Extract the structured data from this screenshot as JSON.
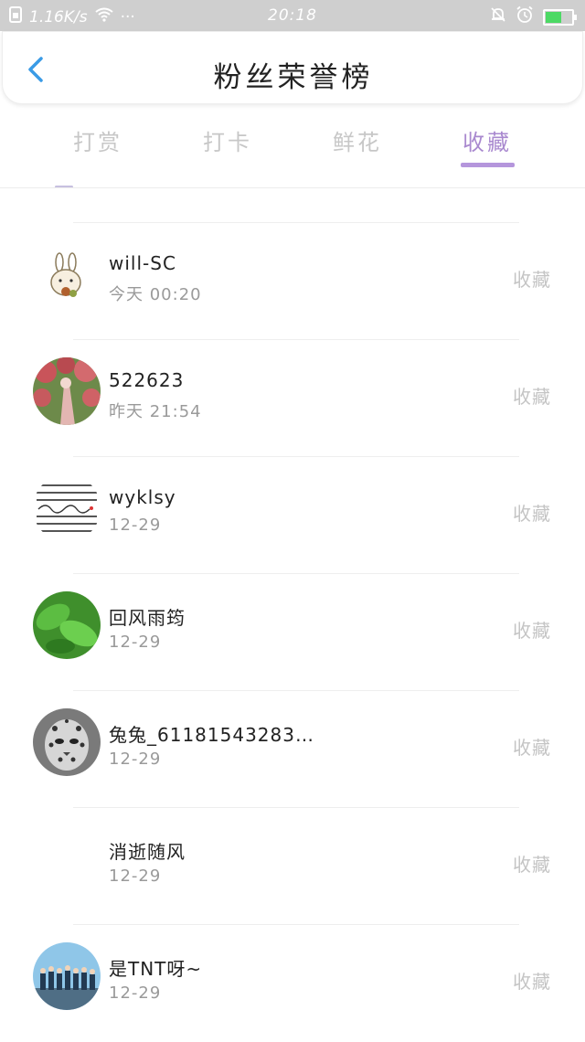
{
  "status_bar": {
    "speed": "1.16K/s",
    "dots": "···",
    "time": "20:18"
  },
  "header": {
    "title": "粉丝荣誉榜"
  },
  "tabs": [
    {
      "label": "打赏",
      "active": false
    },
    {
      "label": "打卡",
      "active": false
    },
    {
      "label": "鲜花",
      "active": false
    },
    {
      "label": "收藏",
      "active": true
    }
  ],
  "colors": {
    "accent": "#a989cf",
    "status_bar": "#cfcfcf",
    "back_arrow": "#3a9be6"
  },
  "list": [
    {
      "name": "will-SC",
      "time": "今天 00:20",
      "action": "收藏",
      "avatar": "bunny-doodle-avatar"
    },
    {
      "name": "522623",
      "time": "昨天 21:54",
      "action": "收藏",
      "avatar": "flower-path-avatar"
    },
    {
      "name": "wyklsy",
      "time": "12-29",
      "action": "收藏",
      "avatar": "striped-i-love-you-avatar"
    },
    {
      "name": "回风雨筠",
      "time": "12-29",
      "action": "收藏",
      "avatar": "green-leaf-avatar"
    },
    {
      "name": "兔兔_61181543283…",
      "time": "12-29",
      "action": "收藏",
      "avatar": "leopard-avatar"
    },
    {
      "name": "消逝随风",
      "time": "12-29",
      "action": "收藏",
      "avatar": "blank-avatar"
    },
    {
      "name": "是TNT呀~",
      "time": "12-29",
      "action": "收藏",
      "avatar": "group-photo-avatar"
    }
  ]
}
